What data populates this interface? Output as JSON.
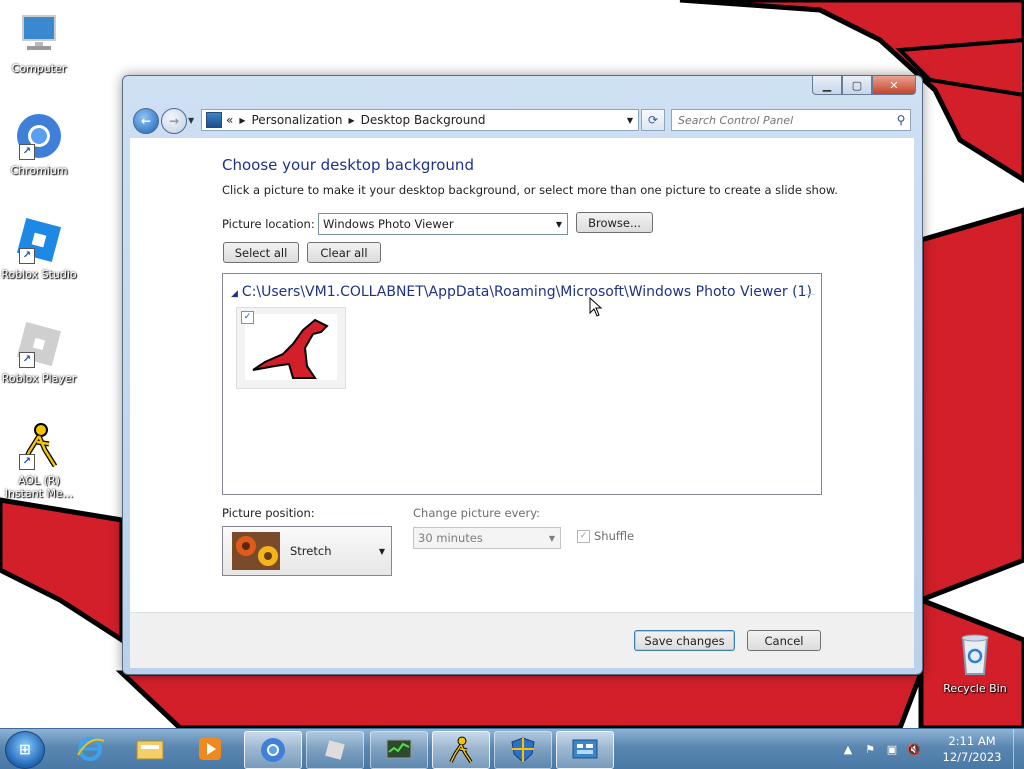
{
  "desktop": {
    "icons": [
      {
        "label": "Computer",
        "icon": "computer-icon"
      },
      {
        "label": "Chromium",
        "icon": "chromium-icon"
      },
      {
        "label": "Roblox Studio",
        "icon": "roblox-studio-icon"
      },
      {
        "label": "Roblox Player",
        "icon": "roblox-player-icon"
      },
      {
        "label": "AOL (R) Instant Me...",
        "icon": "aol-instant-messenger-icon"
      },
      {
        "label": "Recycle Bin",
        "icon": "recycle-bin-icon"
      }
    ]
  },
  "window": {
    "breadcrumb": {
      "overflow": "«",
      "items": [
        "Personalization",
        "Desktop Background"
      ]
    },
    "search": {
      "placeholder": "Search Control Panel"
    },
    "heading": "Choose your desktop background",
    "subtext": "Click a picture to make it your desktop background, or select more than one picture to create a slide show.",
    "picture_location": {
      "label": "Picture location:",
      "value": "Windows Photo Viewer"
    },
    "browse_label": "Browse...",
    "select_all_label": "Select all",
    "clear_all_label": "Clear all",
    "gallery": {
      "group_title": "C:\\Users\\VM1.COLLABNET\\AppData\\Roaming\\Microsoft\\Windows Photo Viewer (1)",
      "items": [
        {
          "checked": true,
          "icon": "red-dinosaur-thumbnail"
        }
      ]
    },
    "picture_position": {
      "label": "Picture position:",
      "value": "Stretch"
    },
    "change_picture": {
      "label": "Change picture every:",
      "value": "30 minutes"
    },
    "shuffle": {
      "label": "Shuffle",
      "checked": true
    },
    "save_label": "Save changes",
    "cancel_label": "Cancel"
  },
  "taskbar": {
    "buttons": [
      "start-orb",
      "internet-explorer-icon",
      "windows-explorer-icon",
      "media-player-icon",
      "chromium-icon",
      "roblox-icon",
      "performance-monitor-icon",
      "aol-instant-messenger-icon",
      "security-center-icon",
      "control-panel-icon"
    ],
    "clock": {
      "time": "2:11 AM",
      "date": "12/7/2023"
    }
  },
  "colors": {
    "heading": "#1e3287",
    "dino_red": "#d21f2a",
    "taskbar": "#5a86b0"
  }
}
